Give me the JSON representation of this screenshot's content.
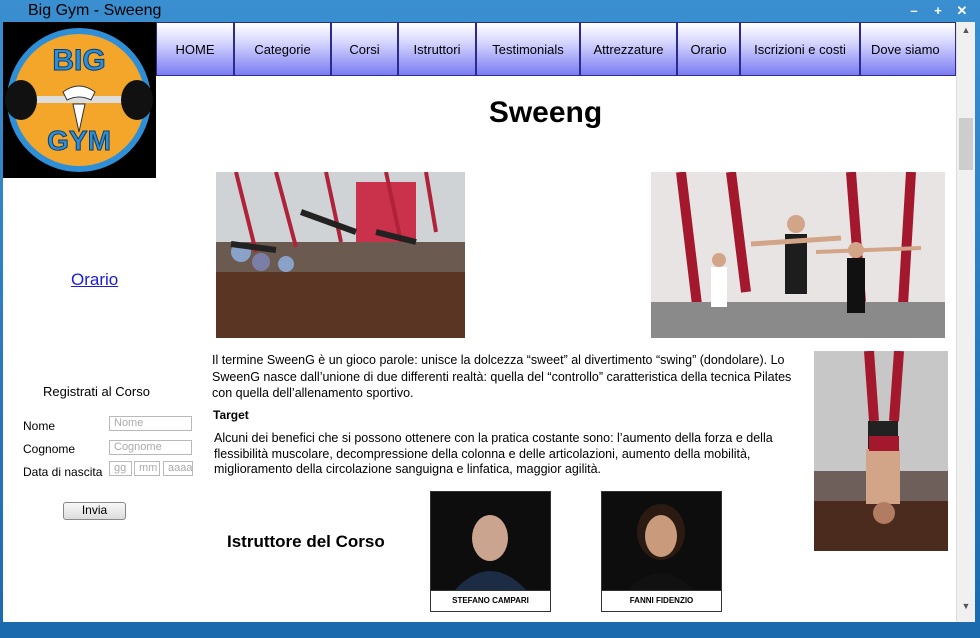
{
  "window": {
    "title": "Big Gym - Sweeng"
  },
  "logo": {
    "top_text": "BIG",
    "bottom_text": "GYM"
  },
  "nav": [
    {
      "label": "HOME"
    },
    {
      "label": "Categorie"
    },
    {
      "label": "Corsi"
    },
    {
      "label": "Istruttori"
    },
    {
      "label": "Testimonials"
    },
    {
      "label": "Attrezzature"
    },
    {
      "label": "Orario"
    },
    {
      "label": "Iscrizioni e costi"
    },
    {
      "label": "Dove siamo"
    }
  ],
  "page_title": "Sweeng",
  "sidebar": {
    "orario_link": "Orario"
  },
  "form": {
    "title": "Registrati al Corso",
    "nome_label": "Nome",
    "nome_placeholder": "Nome",
    "cognome_label": "Cognome",
    "cognome_placeholder": "Cognome",
    "data_label": "Data di nascita",
    "gg_placeholder": "gg",
    "mm_placeholder": "mm",
    "aaaa_placeholder": "aaaa",
    "submit_label": "Invia"
  },
  "content": {
    "description": "Il termine SweenG è un gioco parole: unisce la dolcezza “sweet” al divertimento “swing” (dondolare). Lo SweenG nasce dall’unione di due differenti realtà: quella del “controllo” caratteristica della tecnica Pilates con quella dell’allenamento sportivo.",
    "target_heading": "Target",
    "benefits": "Alcuni dei benefici che si possono ottenere con la pratica costante sono: l’aumento della forza e della flessibilità muscolare, decompressione della colonna e delle articolazioni, aumento della mobilità, miglioramento della circolazione sanguigna e linfatica, maggior agilità.",
    "instructor_heading": "Istruttore del Corso"
  },
  "instructors": [
    {
      "name": "STEFANO CAMPARI"
    },
    {
      "name": "FANNI FIDENZIO"
    }
  ],
  "colors": {
    "accent": "#1b6aae",
    "nav_gradient_bottom": "#7b7bf2",
    "logo_orange": "#f4a62a",
    "logo_blue": "#2f8fd6",
    "link": "#1a1ad9"
  }
}
